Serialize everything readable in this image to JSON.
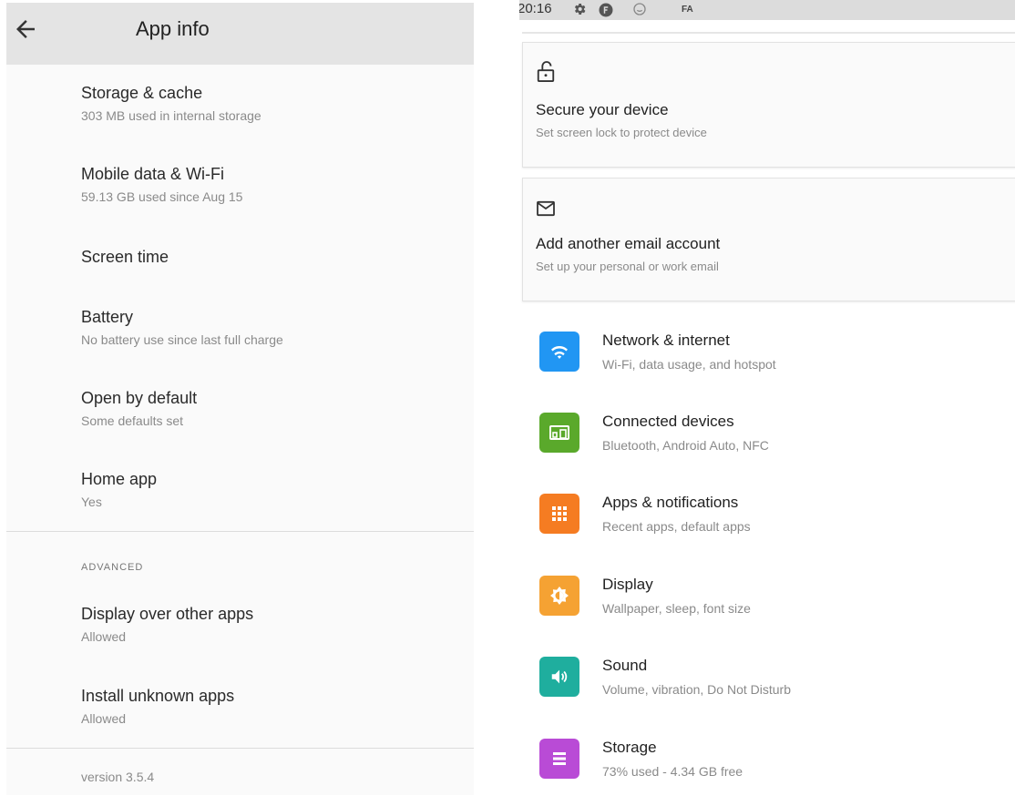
{
  "app_info": {
    "title": "App info",
    "items": [
      {
        "title": "Storage & cache",
        "subtitle": "303 MB used in internal storage"
      },
      {
        "title": "Mobile data & Wi-Fi",
        "subtitle": "59.13 GB used since Aug 15"
      },
      {
        "title": "Screen time",
        "subtitle": ""
      },
      {
        "title": "Battery",
        "subtitle": "No battery use since last full charge"
      },
      {
        "title": "Open by default",
        "subtitle": "Some defaults set"
      },
      {
        "title": "Home app",
        "subtitle": "Yes"
      }
    ],
    "advanced_label": "ADVANCED",
    "advanced_items": [
      {
        "title": "Display over other apps",
        "subtitle": "Allowed"
      },
      {
        "title": "Install unknown apps",
        "subtitle": "Allowed"
      }
    ],
    "version": "version 3.5.4"
  },
  "settings": {
    "status_time": "20:16",
    "status_text": "FA",
    "suggestions": [
      {
        "icon": "unlock-icon",
        "title": "Secure your device",
        "subtitle": "Set screen lock to protect device"
      },
      {
        "icon": "email-icon",
        "title": "Add another email account",
        "subtitle": "Set up your personal or work email"
      }
    ],
    "items": [
      {
        "icon": "wifi-icon",
        "color": "#2196f3",
        "title": "Network & internet",
        "subtitle": "Wi-Fi, data usage, and hotspot"
      },
      {
        "icon": "devices-icon",
        "color": "#5aa92b",
        "title": "Connected devices",
        "subtitle": "Bluetooth, Android Auto, NFC"
      },
      {
        "icon": "apps-grid-icon",
        "color": "#f57c22",
        "title": "Apps & notifications",
        "subtitle": "Recent apps, default apps"
      },
      {
        "icon": "brightness-icon",
        "color": "#f5a233",
        "title": "Display",
        "subtitle": "Wallpaper, sleep, font size"
      },
      {
        "icon": "volume-icon",
        "color": "#1fae9e",
        "title": "Sound",
        "subtitle": "Volume, vibration, Do Not Disturb"
      },
      {
        "icon": "storage-icon",
        "color": "#b94bd6",
        "title": "Storage",
        "subtitle": "73% used - 4.34 GB free"
      }
    ]
  }
}
